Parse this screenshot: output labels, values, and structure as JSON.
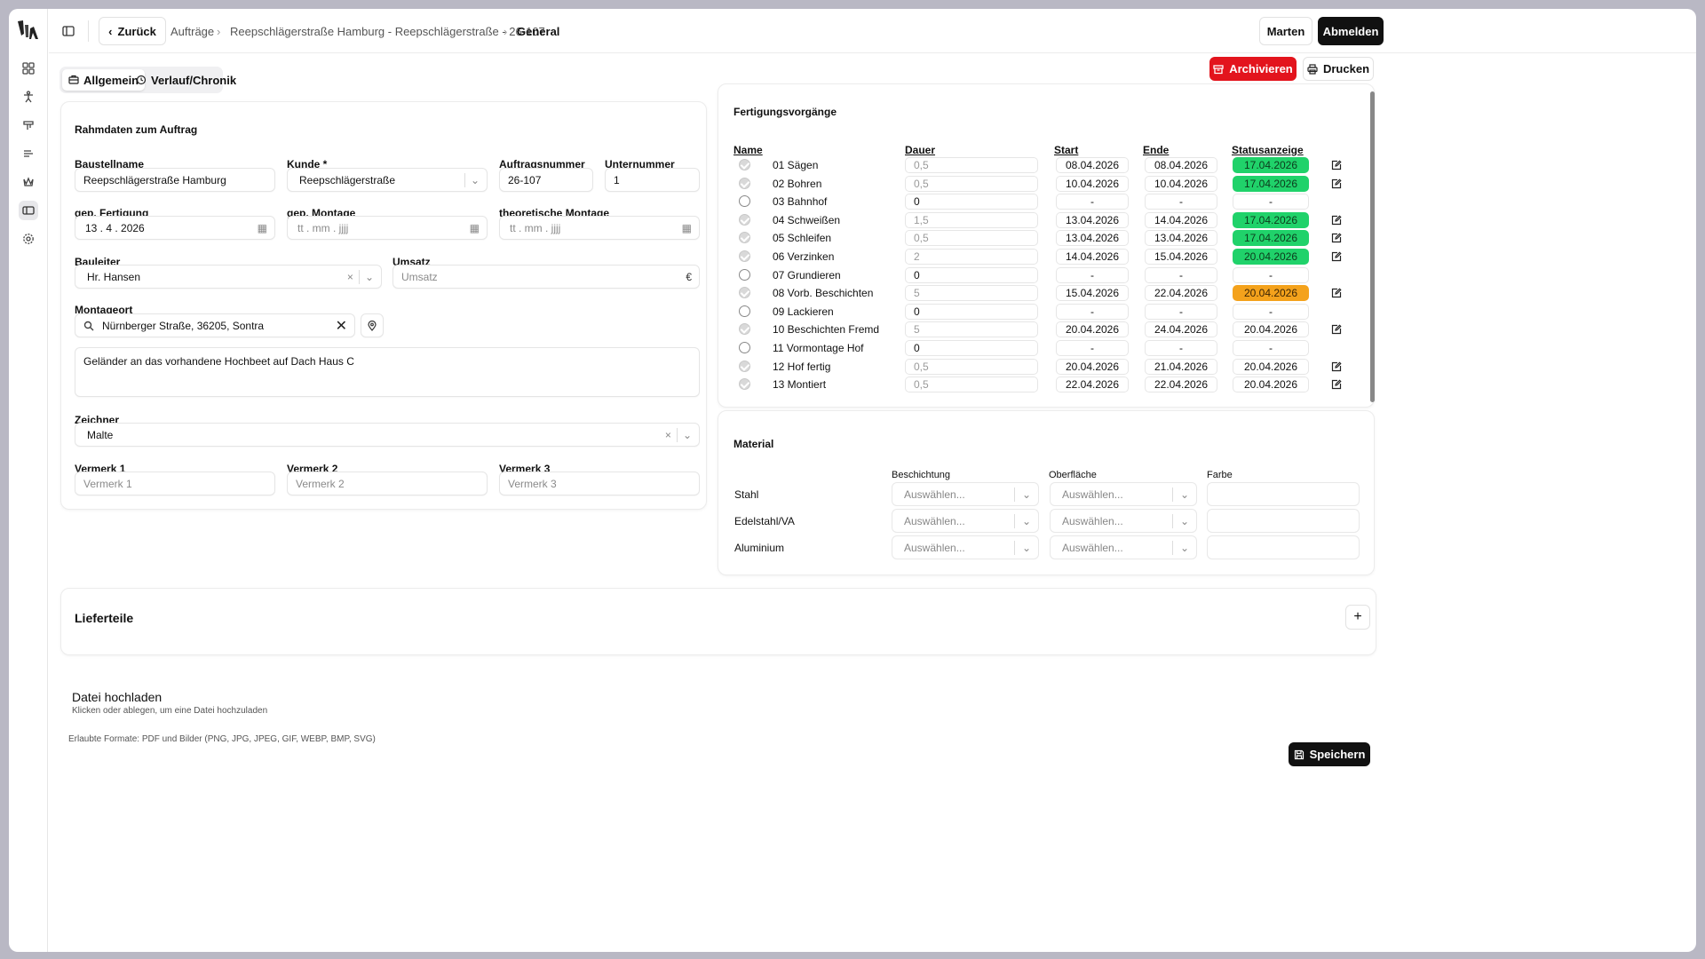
{
  "header": {
    "back_label": "Zurück",
    "crumbs": [
      "Aufträge",
      "Reepschlägerstraße Hamburg - Reepschlägerstraße - 26-107",
      "General"
    ],
    "user_label": "Marten",
    "logout_label": "Abmelden"
  },
  "tabs": {
    "general": "Allgemein",
    "history": "Verlauf/Chronik"
  },
  "actions": {
    "archive": "Archivieren",
    "print": "Drucken",
    "save": "Speichern"
  },
  "frame": {
    "title": "Rahmdaten zum Auftrag",
    "baustellname": {
      "label": "Baustellname",
      "value": "Reepschlägerstraße Hamburg"
    },
    "kunde": {
      "label": "Kunde *",
      "value": "Reepschlägerstraße"
    },
    "auftragsnummer": {
      "label": "Auftragsnummer",
      "value": "26-107"
    },
    "unternummer": {
      "label": "Unternummer",
      "value": "1"
    },
    "fertigung": {
      "label": "gep. Fertigung",
      "value": "13 . 4 . 2026"
    },
    "montage": {
      "label": "gep. Montage",
      "placeholder": "tt . mm . jjjj"
    },
    "theo_montage": {
      "label": "theoretische Montage",
      "placeholder": "tt . mm . jjjj"
    },
    "bauleiter": {
      "label": "Bauleiter",
      "value": "Hr. Hansen"
    },
    "umsatz": {
      "label": "Umsatz",
      "placeholder": "Umsatz",
      "suffix": "€"
    },
    "montageort": {
      "label": "Montageort",
      "value": "Nürnberger Straße, 36205, Sontra"
    },
    "note": "Geländer an das vorhandene Hochbeet auf Dach Haus C",
    "zeichner": {
      "label": "Zeichner",
      "value": "Malte"
    },
    "vermerk1": {
      "label": "Vermerk 1",
      "placeholder": "Vermerk 1"
    },
    "vermerk2": {
      "label": "Vermerk 2",
      "placeholder": "Vermerk 2"
    },
    "vermerk3": {
      "label": "Vermerk 3",
      "placeholder": "Vermerk 3"
    }
  },
  "processes": {
    "title": "Fertigungsvorgänge",
    "headers": {
      "name": "Name",
      "dauer": "Dauer",
      "start": "Start",
      "ende": "Ende",
      "status": "Statusanzeige"
    },
    "rows": [
      {
        "done": true,
        "name": "01 Sägen",
        "dauer": "0,5",
        "start": "08.04.2026",
        "ende": "08.04.2026",
        "status": "17.04.2026",
        "color": "green",
        "edit": true
      },
      {
        "done": true,
        "name": "02 Bohren",
        "dauer": "0,5",
        "start": "10.04.2026",
        "ende": "10.04.2026",
        "status": "17.04.2026",
        "color": "green",
        "edit": true
      },
      {
        "done": false,
        "name": "03 Bahnhof",
        "dauer": "0",
        "start": "-",
        "ende": "-",
        "status": "-",
        "color": "none",
        "edit": false
      },
      {
        "done": true,
        "name": "04 Schweißen",
        "dauer": "1,5",
        "start": "13.04.2026",
        "ende": "14.04.2026",
        "status": "17.04.2026",
        "color": "green",
        "edit": true
      },
      {
        "done": true,
        "name": "05 Schleifen",
        "dauer": "0,5",
        "start": "13.04.2026",
        "ende": "13.04.2026",
        "status": "17.04.2026",
        "color": "green",
        "edit": true
      },
      {
        "done": true,
        "name": "06 Verzinken",
        "dauer": "2",
        "start": "14.04.2026",
        "ende": "15.04.2026",
        "status": "20.04.2026",
        "color": "green",
        "edit": true
      },
      {
        "done": false,
        "name": "07 Grundieren",
        "dauer": "0",
        "start": "-",
        "ende": "-",
        "status": "-",
        "color": "none",
        "edit": false
      },
      {
        "done": true,
        "name": "08 Vorb. Beschichten",
        "dauer": "5",
        "start": "15.04.2026",
        "ende": "22.04.2026",
        "status": "20.04.2026",
        "color": "orange",
        "edit": true
      },
      {
        "done": false,
        "name": "09 Lackieren",
        "dauer": "0",
        "start": "-",
        "ende": "-",
        "status": "-",
        "color": "none",
        "edit": false
      },
      {
        "done": true,
        "name": "10 Beschichten Fremd",
        "dauer": "5",
        "start": "20.04.2026",
        "ende": "24.04.2026",
        "status": "20.04.2026",
        "color": "none",
        "edit": true
      },
      {
        "done": false,
        "name": "11 Vormontage Hof",
        "dauer": "0",
        "start": "-",
        "ende": "-",
        "status": "-",
        "color": "none",
        "edit": false
      },
      {
        "done": true,
        "name": "12 Hof fertig",
        "dauer": "0,5",
        "start": "20.04.2026",
        "ende": "21.04.2026",
        "status": "20.04.2026",
        "color": "none",
        "edit": true
      },
      {
        "done": true,
        "name": "13 Montiert",
        "dauer": "0,5",
        "start": "22.04.2026",
        "ende": "22.04.2026",
        "status": "20.04.2026",
        "color": "none",
        "edit": true
      }
    ]
  },
  "material": {
    "title": "Material",
    "headers": {
      "beschichtung": "Beschichtung",
      "oberflaeche": "Oberfläche",
      "farbe": "Farbe"
    },
    "rows": [
      {
        "name": "Stahl",
        "beschichtung": "Auswählen...",
        "oberflaeche": "Auswählen..."
      },
      {
        "name": "Edelstahl/VA",
        "beschichtung": "Auswählen...",
        "oberflaeche": "Auswählen..."
      },
      {
        "name": "Aluminium",
        "beschichtung": "Auswählen...",
        "oberflaeche": "Auswählen..."
      }
    ]
  },
  "lieferteile": {
    "title": "Lieferteile"
  },
  "upload": {
    "title": "Datei hochladen",
    "hint": "Klicken oder ablegen, um eine Datei hochzuladen",
    "formats": "Erlaubte Formate: PDF und Bilder (PNG, JPG, JPEG, GIF, WEBP, BMP, SVG)"
  }
}
